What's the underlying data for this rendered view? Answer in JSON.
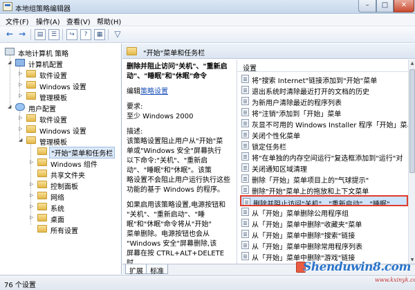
{
  "window": {
    "title": "本地组策略编辑器",
    "min": "–",
    "max": "□",
    "close": "✕"
  },
  "menu": [
    "文件(F)",
    "操作(A)",
    "查看(V)",
    "帮助(H)"
  ],
  "toolbar": {
    "back_icon": "←",
    "forward_icon": "→",
    "folder_icon": "▤",
    "list_icon": "☰",
    "export_icon": "↪",
    "help_icon": "?",
    "props_icon": "▦",
    "filter_icon": "▽"
  },
  "tree": {
    "items": [
      {
        "label": "本地计算机 策略",
        "level": 0,
        "expanded": true,
        "icon": "root-icon"
      },
      {
        "label": "计算机配置",
        "level": 1,
        "expanded": true,
        "icon": "computer-icon"
      },
      {
        "label": "软件设置",
        "level": 2,
        "expanded": false,
        "icon": "folder-icon"
      },
      {
        "label": "Windows 设置",
        "level": 2,
        "expanded": false,
        "icon": "folder-icon"
      },
      {
        "label": "管理模板",
        "level": 2,
        "expanded": false,
        "icon": "folder-icon"
      },
      {
        "label": "用户配置",
        "level": 1,
        "expanded": true,
        "icon": "user-icon"
      },
      {
        "label": "软件设置",
        "level": 2,
        "expanded": false,
        "icon": "folder-icon"
      },
      {
        "label": "Windows 设置",
        "level": 2,
        "expanded": false,
        "icon": "folder-icon"
      },
      {
        "label": "管理模板",
        "level": 2,
        "expanded": true,
        "icon": "folder-icon"
      },
      {
        "label": "\"开始\"菜单和任务栏",
        "level": 3,
        "expanded": false,
        "icon": "folder-icon",
        "selected": true
      },
      {
        "label": "Windows 组件",
        "level": 3,
        "expanded": false,
        "icon": "folder-icon"
      },
      {
        "label": "共享文件夹",
        "level": 3,
        "expanded": false,
        "icon": "folder-icon"
      },
      {
        "label": "控制面板",
        "level": 3,
        "expanded": false,
        "icon": "folder-icon"
      },
      {
        "label": "网络",
        "level": 3,
        "expanded": false,
        "icon": "folder-icon"
      },
      {
        "label": "系统",
        "level": 3,
        "expanded": false,
        "icon": "folder-icon"
      },
      {
        "label": "桌面",
        "level": 3,
        "expanded": false,
        "icon": "folder-icon"
      },
      {
        "label": "所有设置",
        "level": 3,
        "expanded": false,
        "icon": "folder-icon"
      }
    ]
  },
  "path_header": "\"开始\"菜单和任务栏",
  "description": {
    "title_lines": [
      "删除并阻止访问\"关机\"、\"重新启",
      "动\"、\"睡眠\"和\"休眠\"命令"
    ],
    "edit_prefix": "编辑",
    "edit_link": "策略设置",
    "requirements_label": "要求:",
    "requirements_value": "至少 Windows 2000",
    "desc_label": "描述:",
    "desc_lines": [
      "该策略设置阻止用户从\"开始\"菜",
      "单或\"Windows 安全\"屏幕执行",
      "以下命令:\"关机\"、\"重新启",
      "动\"、\"睡眠\"和\"休眠\"。该策",
      "略设置不会阻止用户运行执行这些",
      "功能的基于 Windows 的程序。"
    ],
    "detail_lines": [
      "如果启用该策略设置,电源按钮和",
      "\"关机\"、\"重新启动\"、\"睡",
      "眠\"和\"休眠\"命令将从\"开始\"",
      "菜单删除。电源按钮也会从",
      "\"Windows 安全\"屏幕删除,该",
      "屏幕在按 CTRL+ALT+DELETE 时"
    ]
  },
  "settings": {
    "header": "设置",
    "items": [
      "将\"搜索 Internet\"链接添加到\"开始\"菜单",
      "退出系统时清除最近打开的文档的历史",
      "为新用户清除最近的程序列表",
      "将\"注销\"添加到「开始」菜单",
      "灰显不可用的 Windows Installer 程序「开始」菜单",
      "关闭个性化菜单",
      "锁定任务栏",
      "将\"在单独的内存空间运行\"复选框添加到\"运行\"对",
      "关闭通知区域清理",
      "删除「开始」菜单项目上的\"气球提示\"",
      "删除\"开始\"菜单上的拖放和上下文菜单",
      "删除并阻止访问\"关机\"、\"重新启动\"、\"睡眠\"",
      "从「开始」菜单删除公用程序组",
      "从「开始」菜单中删除\"收藏夹\"菜单",
      "从「开始」菜单中删除\"搜索\"链接",
      "从「开始」菜单中删除常用程序列表",
      "从「开始」菜单中删除\"游戏\"链接"
    ],
    "selected_index": 11
  },
  "tabs": [
    "扩展",
    "标准"
  ],
  "active_tab": 0,
  "status": {
    "count": "76 个设置"
  },
  "watermark": {
    "text": "Shenduwin8.com",
    "sub": "www.kxinyk.com"
  },
  "colors": {
    "selection_border": "#e23b2b",
    "selection_fill": "#cfe3fb",
    "link": "#1a50b8"
  }
}
